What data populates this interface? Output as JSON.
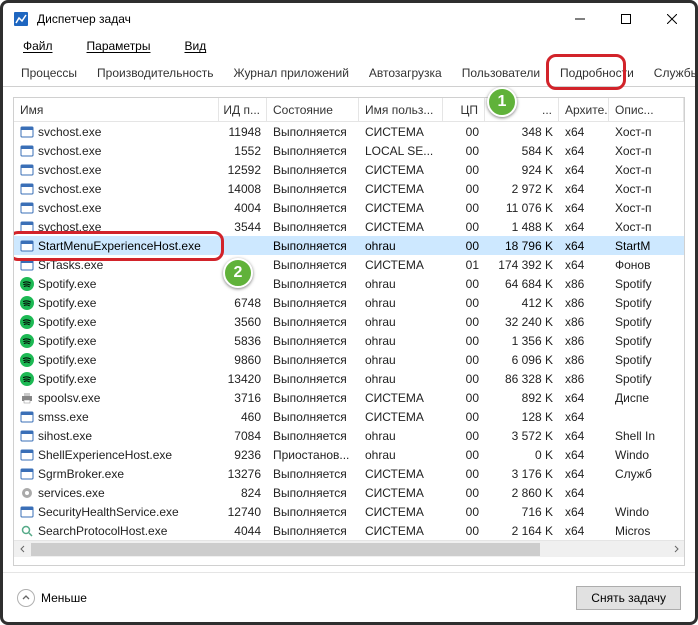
{
  "window": {
    "title": "Диспетчер задач"
  },
  "menu": {
    "file": "Файл",
    "options": "Параметры",
    "view": "Вид"
  },
  "tabs": {
    "t0": "Процессы",
    "t1": "Производительность",
    "t2": "Журнал приложений",
    "t3": "Автозагрузка",
    "t4": "Пользователи",
    "t5": "Подробности",
    "t6": "Службы"
  },
  "columns": {
    "name": "Имя",
    "pid": "ИД п...",
    "state": "Состояние",
    "user": "Имя польз...",
    "cpu": "ЦП",
    "mem": "...",
    "arch": "Архите...",
    "desc": "Опис..."
  },
  "rows": [
    {
      "icon": "svc",
      "name": "svchost.exe",
      "pid": "11948",
      "state": "Выполняется",
      "user": "СИСТЕМА",
      "cpu": "00",
      "mem": "348 K",
      "arch": "x64",
      "desc": "Хост-п"
    },
    {
      "icon": "svc",
      "name": "svchost.exe",
      "pid": "1552",
      "state": "Выполняется",
      "user": "LOCAL SE...",
      "cpu": "00",
      "mem": "584 K",
      "arch": "x64",
      "desc": "Хост-п"
    },
    {
      "icon": "svc",
      "name": "svchost.exe",
      "pid": "12592",
      "state": "Выполняется",
      "user": "СИСТЕМА",
      "cpu": "00",
      "mem": "924 K",
      "arch": "x64",
      "desc": "Хост-п"
    },
    {
      "icon": "svc",
      "name": "svchost.exe",
      "pid": "14008",
      "state": "Выполняется",
      "user": "СИСТЕМА",
      "cpu": "00",
      "mem": "2 972 K",
      "arch": "x64",
      "desc": "Хост-п"
    },
    {
      "icon": "svc",
      "name": "svchost.exe",
      "pid": "4004",
      "state": "Выполняется",
      "user": "СИСТЕМА",
      "cpu": "00",
      "mem": "11 076 K",
      "arch": "x64",
      "desc": "Хост-п"
    },
    {
      "icon": "svc",
      "name": "svchost.exe",
      "pid": "3544",
      "state": "Выполняется",
      "user": "СИСТЕМА",
      "cpu": "00",
      "mem": "1 488 K",
      "arch": "x64",
      "desc": "Хост-п"
    },
    {
      "icon": "svc",
      "name": "StartMenuExperienceHost.exe",
      "pid": "",
      "state": "Выполняется",
      "user": "ohrau",
      "cpu": "00",
      "mem": "18 796 K",
      "arch": "x64",
      "desc": "StartM",
      "sel": true
    },
    {
      "icon": "svc",
      "name": "SrTasks.exe",
      "pid": "",
      "state": "Выполняется",
      "user": "СИСТЕМА",
      "cpu": "01",
      "mem": "174 392 K",
      "arch": "x64",
      "desc": "Фонов"
    },
    {
      "icon": "spot",
      "name": "Spotify.exe",
      "pid": "",
      "state": "Выполняется",
      "user": "ohrau",
      "cpu": "00",
      "mem": "64 684 K",
      "arch": "x86",
      "desc": "Spotify"
    },
    {
      "icon": "spot",
      "name": "Spotify.exe",
      "pid": "6748",
      "state": "Выполняется",
      "user": "ohrau",
      "cpu": "00",
      "mem": "412 K",
      "arch": "x86",
      "desc": "Spotify"
    },
    {
      "icon": "spot",
      "name": "Spotify.exe",
      "pid": "3560",
      "state": "Выполняется",
      "user": "ohrau",
      "cpu": "00",
      "mem": "32 240 K",
      "arch": "x86",
      "desc": "Spotify"
    },
    {
      "icon": "spot",
      "name": "Spotify.exe",
      "pid": "5836",
      "state": "Выполняется",
      "user": "ohrau",
      "cpu": "00",
      "mem": "1 356 K",
      "arch": "x86",
      "desc": "Spotify"
    },
    {
      "icon": "spot",
      "name": "Spotify.exe",
      "pid": "9860",
      "state": "Выполняется",
      "user": "ohrau",
      "cpu": "00",
      "mem": "6 096 K",
      "arch": "x86",
      "desc": "Spotify"
    },
    {
      "icon": "spot",
      "name": "Spotify.exe",
      "pid": "13420",
      "state": "Выполняется",
      "user": "ohrau",
      "cpu": "00",
      "mem": "86 328 K",
      "arch": "x86",
      "desc": "Spotify"
    },
    {
      "icon": "prn",
      "name": "spoolsv.exe",
      "pid": "3716",
      "state": "Выполняется",
      "user": "СИСТЕМА",
      "cpu": "00",
      "mem": "892 K",
      "arch": "x64",
      "desc": "Диспе"
    },
    {
      "icon": "svc",
      "name": "smss.exe",
      "pid": "460",
      "state": "Выполняется",
      "user": "СИСТЕМА",
      "cpu": "00",
      "mem": "128 K",
      "arch": "x64",
      "desc": ""
    },
    {
      "icon": "svc",
      "name": "sihost.exe",
      "pid": "7084",
      "state": "Выполняется",
      "user": "ohrau",
      "cpu": "00",
      "mem": "3 572 K",
      "arch": "x64",
      "desc": "Shell In"
    },
    {
      "icon": "svc",
      "name": "ShellExperienceHost.exe",
      "pid": "9236",
      "state": "Приостанов...",
      "user": "ohrau",
      "cpu": "00",
      "mem": "0 K",
      "arch": "x64",
      "desc": "Windo"
    },
    {
      "icon": "svc",
      "name": "SgrmBroker.exe",
      "pid": "13276",
      "state": "Выполняется",
      "user": "СИСТЕМА",
      "cpu": "00",
      "mem": "3 176 K",
      "arch": "x64",
      "desc": "Служб"
    },
    {
      "icon": "gear",
      "name": "services.exe",
      "pid": "824",
      "state": "Выполняется",
      "user": "СИСТЕМА",
      "cpu": "00",
      "mem": "2 860 K",
      "arch": "x64",
      "desc": ""
    },
    {
      "icon": "svc",
      "name": "SecurityHealthService.exe",
      "pid": "12740",
      "state": "Выполняется",
      "user": "СИСТЕМА",
      "cpu": "00",
      "mem": "716 K",
      "arch": "x64",
      "desc": "Windo"
    },
    {
      "icon": "srch",
      "name": "SearchProtocolHost.exe",
      "pid": "4044",
      "state": "Выполняется",
      "user": "СИСТЕМА",
      "cpu": "00",
      "mem": "2 164 K",
      "arch": "x64",
      "desc": "Micros"
    }
  ],
  "footer": {
    "fewer": "Меньше",
    "end_task": "Снять задачу"
  },
  "annotations": {
    "a1": "1",
    "a2": "2"
  }
}
